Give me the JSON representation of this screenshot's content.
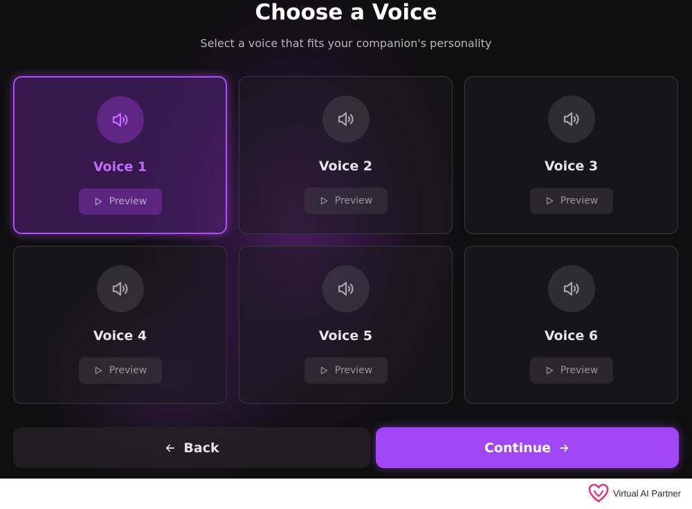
{
  "header": {
    "title": "Choose a Voice",
    "subtitle": "Select a voice that fits your companion's personality"
  },
  "voices": [
    {
      "name": "Voice 1",
      "preview_label": "Preview",
      "selected": true
    },
    {
      "name": "Voice 2",
      "preview_label": "Preview",
      "selected": false
    },
    {
      "name": "Voice 3",
      "preview_label": "Preview",
      "selected": false
    },
    {
      "name": "Voice 4",
      "preview_label": "Preview",
      "selected": false
    },
    {
      "name": "Voice 5",
      "preview_label": "Preview",
      "selected": false
    },
    {
      "name": "Voice 6",
      "preview_label": "Preview",
      "selected": false
    }
  ],
  "icons": {
    "voice": "speaker-icon",
    "preview": "play-icon",
    "back": "arrow-left-icon",
    "continue": "arrow-right-icon",
    "brand": "heart-logo-icon"
  },
  "footer": {
    "back_label": "Back",
    "continue_label": "Continue"
  },
  "brand": {
    "name": "Virtual AI Partner"
  },
  "colors": {
    "accent": "#a146f5",
    "selected_text": "#c46cff",
    "background": "#0f0f10",
    "brand_pink": "#e0357a"
  }
}
